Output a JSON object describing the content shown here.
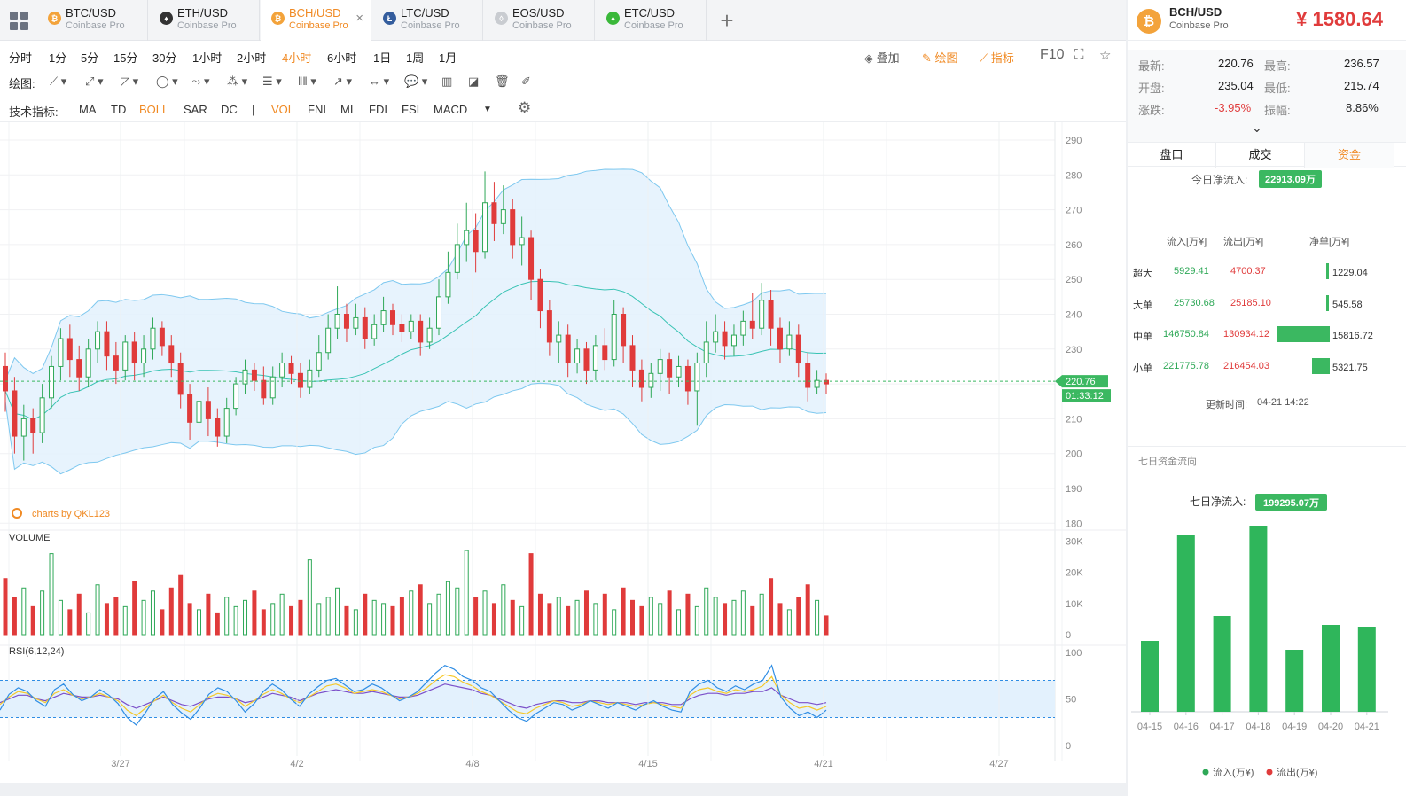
{
  "tabs": [
    {
      "pair": "BTC/USD",
      "exchange": "Coinbase Pro",
      "color": "#f3a33b",
      "glyph": "₿",
      "active": false
    },
    {
      "pair": "ETH/USD",
      "exchange": "Coinbase Pro",
      "color": "#333333",
      "glyph": "♦",
      "active": false
    },
    {
      "pair": "BCH/USD",
      "exchange": "Coinbase Pro",
      "color": "#f3a33b",
      "glyph": "₿",
      "active": true
    },
    {
      "pair": "LTC/USD",
      "exchange": "Coinbase Pro",
      "color": "#345d9d",
      "glyph": "Ł",
      "active": false
    },
    {
      "pair": "EOS/USD",
      "exchange": "Coinbase Pro",
      "color": "#c9ccd1",
      "glyph": "◊",
      "active": false
    },
    {
      "pair": "ETC/USD",
      "exchange": "Coinbase Pro",
      "color": "#3ab83a",
      "glyph": "♦",
      "active": false
    }
  ],
  "timeframes": [
    "分时",
    "1分",
    "5分",
    "15分",
    "30分",
    "1小时",
    "2小时",
    "4小时",
    "6小时",
    "1日",
    "1周",
    "1月"
  ],
  "active_timeframe": "4小时",
  "right_tools": {
    "overlay": "叠加",
    "draw": "绘图",
    "indicator": "指标",
    "f10": "F10"
  },
  "draw_label": "绘图:",
  "indicator_label": "技术指标:",
  "indicators": [
    "MA",
    "TD",
    "BOLL",
    "SAR",
    "DC",
    "|",
    "VOL",
    "FNI",
    "MI",
    "FDI",
    "FSI",
    "MACD"
  ],
  "active_indicators": [
    "BOLL",
    "VOL"
  ],
  "chart_data": {
    "type": "candlestick",
    "price_axis": [
      290,
      280,
      270,
      260,
      250,
      240,
      230,
      220,
      210,
      200,
      190,
      180
    ],
    "volume_label": "VOLUME",
    "volume_axis": [
      "30K",
      "20K",
      "10K",
      "0"
    ],
    "rsi_label": "RSI(6,12,24)",
    "rsi_axis": [
      100,
      50,
      0
    ],
    "x_labels": [
      "3/27",
      "4/2",
      "4/8",
      "4/15",
      "4/21",
      "4/27"
    ],
    "last_price": "220.76",
    "countdown": "01:33:12",
    "watermark": "charts by QKL123",
    "colors": {
      "up": "#2ea857",
      "down": "#e03b3b",
      "boll": "#7ec8ef",
      "band": "#e3f1fd",
      "mid": "#39c3b4",
      "rsi6": "#2f8de4",
      "rsi12": "#f5c82a",
      "rsi24": "#7b4fc9"
    },
    "candles": [
      [
        225,
        218,
        229,
        212
      ],
      [
        218,
        205,
        222,
        200
      ],
      [
        205,
        210,
        214,
        198
      ],
      [
        210,
        206,
        213,
        200
      ],
      [
        206,
        216,
        220,
        203
      ],
      [
        216,
        225,
        228,
        213
      ],
      [
        225,
        233,
        236,
        221
      ],
      [
        233,
        227,
        237,
        222
      ],
      [
        227,
        222,
        231,
        218
      ],
      [
        222,
        230,
        233,
        219
      ],
      [
        230,
        235,
        238,
        226
      ],
      [
        235,
        228,
        238,
        224
      ],
      [
        228,
        224,
        232,
        220
      ],
      [
        224,
        232,
        234,
        221
      ],
      [
        232,
        226,
        235,
        221
      ],
      [
        226,
        230,
        234,
        222
      ],
      [
        230,
        236,
        239,
        227
      ],
      [
        236,
        231,
        238,
        228
      ],
      [
        231,
        226,
        234,
        222
      ],
      [
        226,
        217,
        229,
        213
      ],
      [
        217,
        209,
        220,
        204
      ],
      [
        209,
        215,
        218,
        206
      ],
      [
        215,
        210,
        219,
        205
      ],
      [
        210,
        205,
        213,
        202
      ],
      [
        205,
        213,
        216,
        203
      ],
      [
        213,
        220,
        222,
        211
      ],
      [
        220,
        224,
        227,
        217
      ],
      [
        224,
        221,
        226,
        218
      ],
      [
        221,
        216,
        225,
        214
      ],
      [
        216,
        222,
        225,
        214
      ],
      [
        222,
        226,
        229,
        219
      ],
      [
        226,
        223,
        228,
        220
      ],
      [
        223,
        219,
        226,
        216
      ],
      [
        219,
        224,
        227,
        217
      ],
      [
        224,
        229,
        234,
        222
      ],
      [
        229,
        236,
        240,
        227
      ],
      [
        236,
        240,
        248,
        233
      ],
      [
        240,
        236,
        243,
        232
      ],
      [
        236,
        239,
        243,
        234
      ],
      [
        239,
        233,
        242,
        230
      ],
      [
        233,
        237,
        240,
        231
      ],
      [
        237,
        241,
        245,
        235
      ],
      [
        241,
        237,
        243,
        234
      ],
      [
        237,
        235,
        240,
        232
      ],
      [
        235,
        238,
        240,
        233
      ],
      [
        238,
        232,
        240,
        228
      ],
      [
        232,
        236,
        239,
        230
      ],
      [
        236,
        245,
        250,
        234
      ],
      [
        245,
        252,
        258,
        243
      ],
      [
        252,
        260,
        266,
        250
      ],
      [
        260,
        264,
        272,
        255
      ],
      [
        264,
        258,
        269,
        252
      ],
      [
        258,
        272,
        281,
        256
      ],
      [
        272,
        266,
        278,
        261
      ],
      [
        266,
        270,
        277,
        263
      ],
      [
        270,
        260,
        273,
        256
      ],
      [
        260,
        262,
        268,
        254
      ],
      [
        262,
        250,
        264,
        244
      ],
      [
        250,
        241,
        253,
        236
      ],
      [
        241,
        232,
        244,
        228
      ],
      [
        232,
        234,
        238,
        226
      ],
      [
        234,
        226,
        237,
        222
      ],
      [
        226,
        230,
        233,
        223
      ],
      [
        230,
        224,
        232,
        220
      ],
      [
        224,
        231,
        234,
        221
      ],
      [
        231,
        227,
        236,
        224
      ],
      [
        227,
        240,
        244,
        225
      ],
      [
        240,
        231,
        242,
        226
      ],
      [
        231,
        224,
        234,
        219
      ],
      [
        224,
        219,
        227,
        215
      ],
      [
        219,
        223,
        226,
        216
      ],
      [
        223,
        227,
        230,
        218
      ],
      [
        227,
        222,
        229,
        217
      ],
      [
        222,
        225,
        228,
        219
      ],
      [
        225,
        218,
        227,
        214
      ],
      [
        218,
        226,
        229,
        208
      ],
      [
        226,
        232,
        238,
        222
      ],
      [
        232,
        235,
        240,
        229
      ],
      [
        235,
        231,
        238,
        227
      ],
      [
        231,
        234,
        237,
        228
      ],
      [
        234,
        238,
        241,
        231
      ],
      [
        238,
        236,
        246,
        233
      ],
      [
        236,
        244,
        249,
        234
      ],
      [
        244,
        236,
        247,
        231
      ],
      [
        236,
        230,
        239,
        226
      ],
      [
        230,
        234,
        238,
        228
      ],
      [
        234,
        226,
        237,
        222
      ],
      [
        226,
        219,
        229,
        215
      ],
      [
        219,
        221,
        224,
        217
      ],
      [
        221,
        220,
        223,
        217
      ]
    ],
    "volumes": [
      18,
      12,
      15,
      9,
      14,
      26,
      11,
      8,
      13,
      7,
      16,
      10,
      12,
      9,
      17,
      11,
      14,
      8,
      15,
      19,
      10,
      8,
      13,
      7,
      12,
      9,
      11,
      14,
      8,
      10,
      13,
      9,
      11,
      24,
      10,
      12,
      15,
      9,
      8,
      13,
      11,
      10,
      9,
      12,
      14,
      16,
      10,
      13,
      17,
      15,
      27,
      12,
      14,
      10,
      16,
      11,
      9,
      26,
      13,
      10,
      12,
      9,
      11,
      14,
      10,
      13,
      8,
      15,
      11,
      9,
      12,
      10,
      14,
      8,
      13,
      9,
      15,
      12,
      10,
      11,
      14,
      9,
      13,
      18,
      10,
      8,
      12,
      16,
      11,
      6
    ],
    "rsi6": [
      38,
      55,
      62,
      58,
      48,
      42,
      60,
      66,
      55,
      48,
      52,
      60,
      54,
      45,
      30,
      22,
      35,
      50,
      58,
      44,
      35,
      28,
      40,
      55,
      62,
      58,
      48,
      36,
      45,
      58,
      66,
      60,
      50,
      42,
      55,
      63,
      70,
      72,
      65,
      58,
      60,
      66,
      62,
      55,
      48,
      52,
      58,
      68,
      78,
      86,
      82,
      74,
      70,
      62,
      58,
      48,
      38,
      30,
      26,
      34,
      40,
      46,
      44,
      38,
      42,
      48,
      44,
      40,
      46,
      42,
      38,
      44,
      48,
      42,
      38,
      36,
      58,
      66,
      70,
      62,
      58,
      64,
      60,
      66,
      70,
      86,
      52,
      40,
      32,
      36,
      30,
      38
    ],
    "rsi12": [
      44,
      52,
      58,
      56,
      50,
      46,
      56,
      60,
      54,
      50,
      52,
      56,
      52,
      48,
      38,
      32,
      40,
      48,
      54,
      46,
      40,
      36,
      44,
      52,
      56,
      54,
      50,
      42,
      48,
      55,
      60,
      56,
      50,
      46,
      52,
      58,
      64,
      66,
      62,
      56,
      58,
      60,
      58,
      54,
      50,
      52,
      56,
      62,
      70,
      76,
      74,
      68,
      64,
      58,
      54,
      48,
      42,
      36,
      34,
      40,
      44,
      48,
      46,
      42,
      44,
      48,
      46,
      44,
      46,
      44,
      42,
      44,
      46,
      44,
      42,
      40,
      54,
      60,
      62,
      58,
      56,
      60,
      58,
      60,
      64,
      74,
      54,
      46,
      40,
      42,
      38,
      42
    ],
    "rsi24": [
      46,
      50,
      54,
      54,
      50,
      48,
      52,
      56,
      54,
      52,
      52,
      54,
      52,
      50,
      44,
      40,
      44,
      48,
      52,
      48,
      44,
      42,
      46,
      50,
      52,
      52,
      50,
      46,
      48,
      52,
      56,
      54,
      52,
      48,
      52,
      56,
      58,
      60,
      58,
      56,
      56,
      58,
      56,
      54,
      52,
      52,
      54,
      58,
      62,
      66,
      64,
      62,
      60,
      56,
      54,
      50,
      46,
      42,
      40,
      44,
      46,
      48,
      48,
      46,
      46,
      48,
      48,
      46,
      46,
      46,
      44,
      46,
      46,
      46,
      44,
      44,
      50,
      54,
      56,
      56,
      54,
      56,
      56,
      58,
      58,
      62,
      54,
      50,
      46,
      46,
      44,
      46
    ]
  },
  "ticker": {
    "pair": "BCH/USD",
    "exchange": "Coinbase Pro",
    "price": "¥ 1580.64"
  },
  "stats": {
    "latest_label": "最新:",
    "latest": "220.76",
    "high_label": "最高:",
    "high": "236.57",
    "open_label": "开盘:",
    "open": "235.04",
    "low_label": "最低:",
    "low": "215.74",
    "change_label": "涨跌:",
    "change": "-3.95%",
    "amplitude_label": "振幅:",
    "amplitude": "8.86%"
  },
  "panel_tabs": [
    "盘口",
    "成交",
    "资金"
  ],
  "active_panel_tab": "资金",
  "fund": {
    "today_label": "今日净流入:",
    "today_value": "22913.09万",
    "headers": [
      "流入[万¥]",
      "流出[万¥]",
      "净单[万¥]"
    ],
    "rows": [
      {
        "label": "超大",
        "in": "5929.41",
        "out": "4700.37",
        "net": "1229.04",
        "frac": 0.08
      },
      {
        "label": "大单",
        "in": "25730.68",
        "out": "25185.10",
        "net": "545.58",
        "frac": 0.035
      },
      {
        "label": "中单",
        "in": "146750.84",
        "out": "130934.12",
        "net": "15816.72",
        "frac": 1.0
      },
      {
        "label": "小单",
        "in": "221775.78",
        "out": "216454.03",
        "net": "5321.75",
        "frac": 0.34
      }
    ],
    "update_label": "更新时间:",
    "update_time": "04-21 14:22"
  },
  "week": {
    "section_title": "七日资金流向",
    "net_label": "七日净流入:",
    "net_value": "199295.07万",
    "dates": [
      "04-15",
      "04-16",
      "04-17",
      "04-18",
      "04-19",
      "04-20",
      "04-21"
    ],
    "values": [
      40,
      100,
      54,
      105,
      35,
      49,
      48
    ],
    "legend_in": "流入(万¥)",
    "legend_out": "流出(万¥)"
  }
}
